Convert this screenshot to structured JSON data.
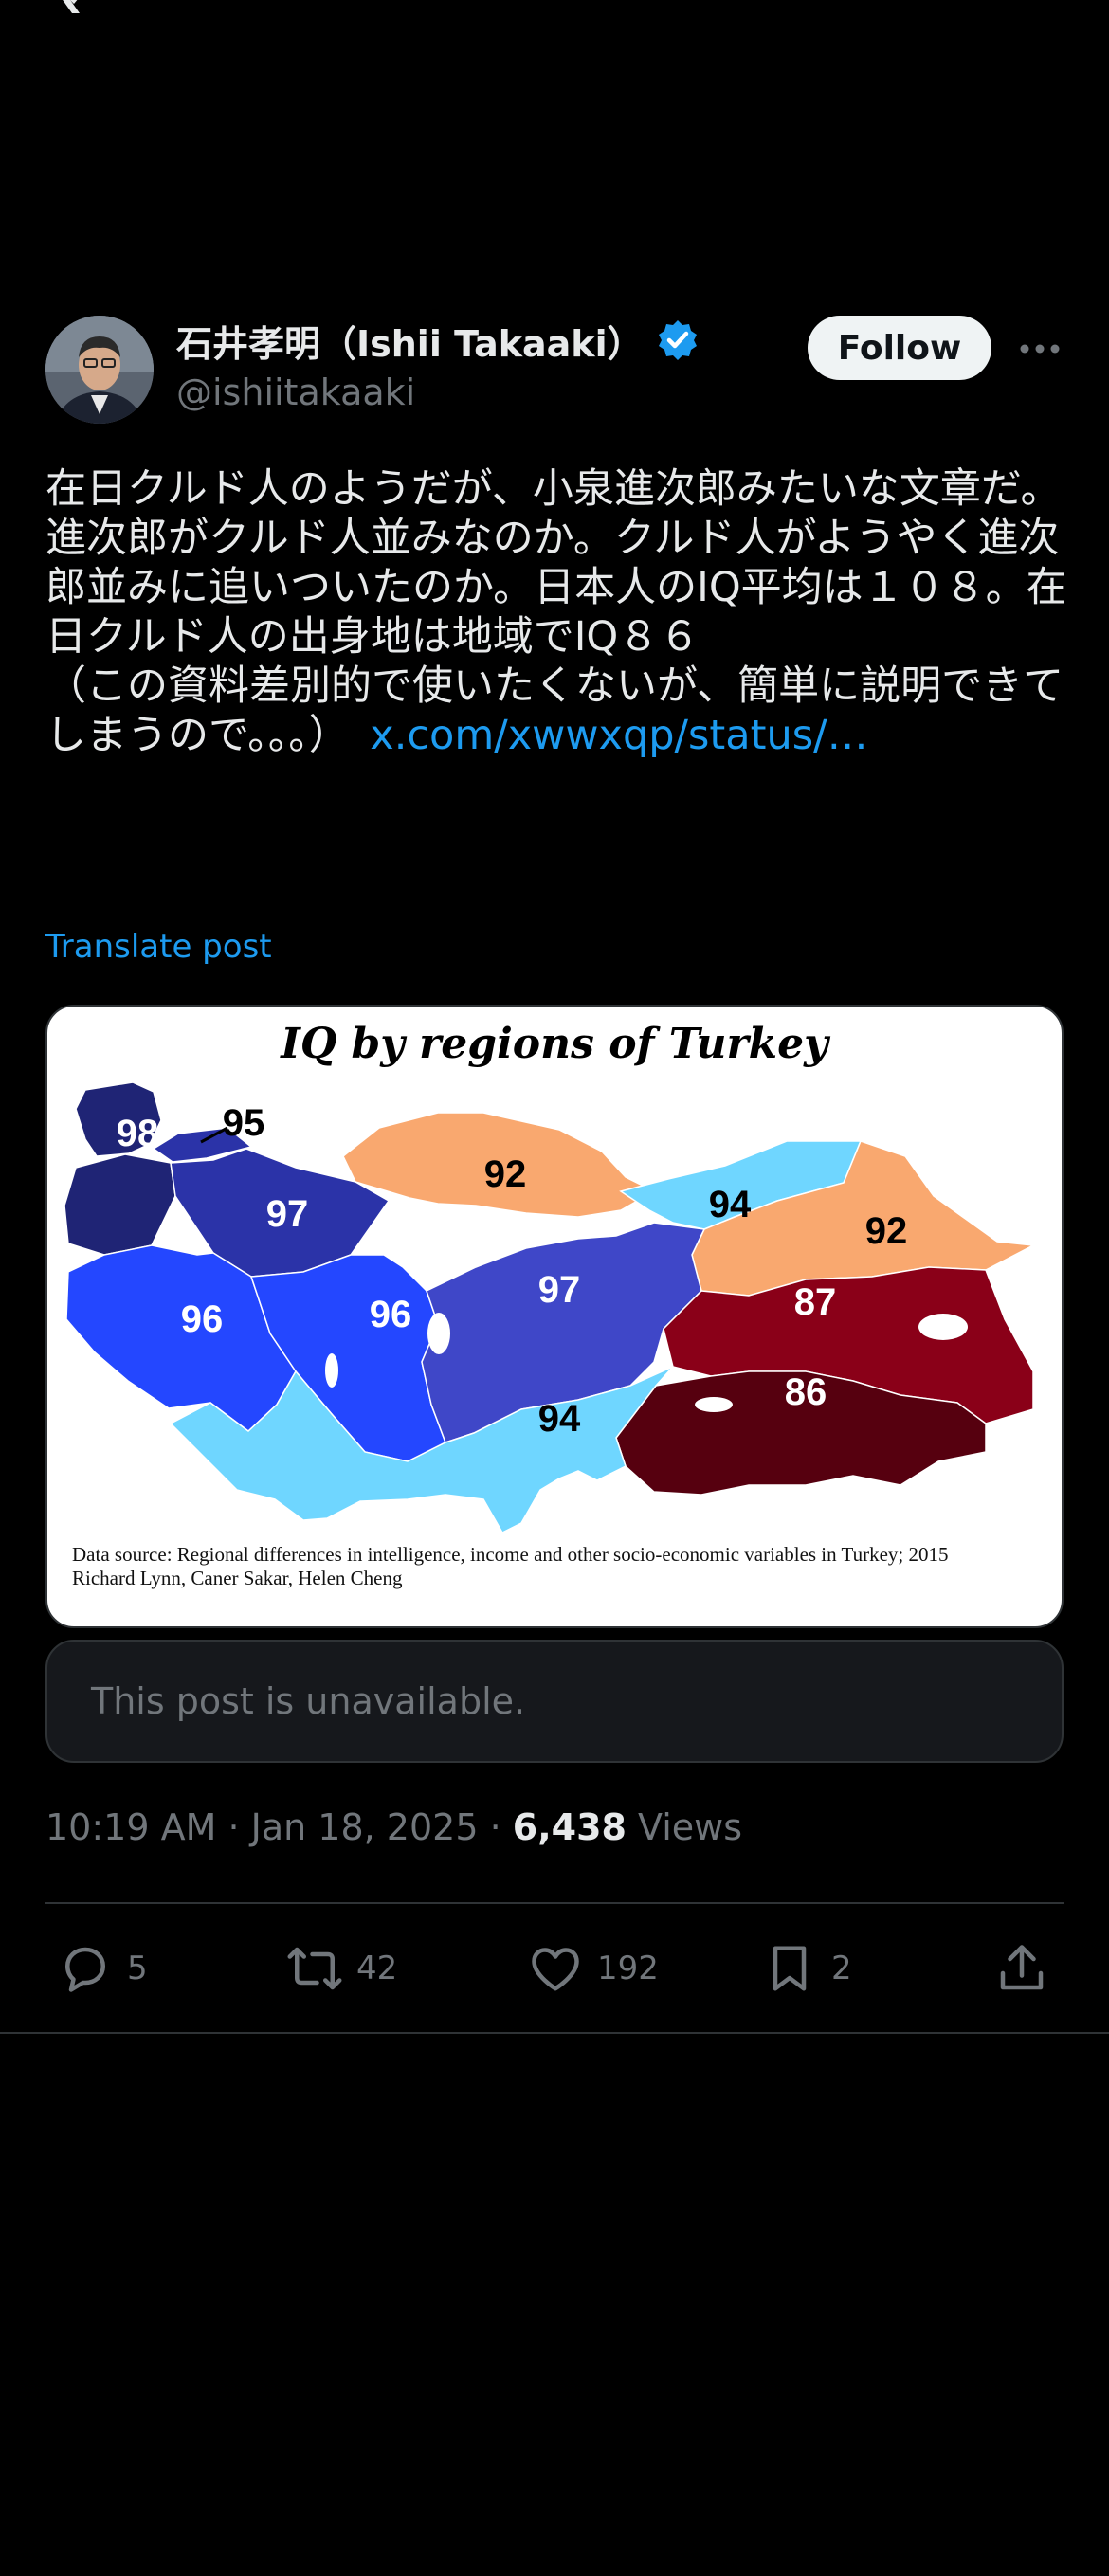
{
  "author": {
    "display_name": "石井孝明（Ishii Takaaki）",
    "handle": "@ishiitakaaki"
  },
  "follow_label": "Follow",
  "tweet": {
    "text": "在日クルド人のようだが、小泉進次郎みたいな文章だ。進次郎がクルド人並みなのか。クルド人がようやく進次郎並みに追いついたのか。日本人のIQ平均は１０８。在日クルド人の出身地は地域でIQ８６\n（この資料差別的で使いたくないが、簡単に説明できてしまうので。。。）　",
    "link": "x.com/xwwxqp/status/…",
    "translate_label": "Translate post"
  },
  "media": {
    "title": "IQ by regions of Turkey",
    "labels": [
      "98",
      "95",
      "92",
      "97",
      "94",
      "92",
      "96",
      "96",
      "97",
      "87",
      "86",
      "94"
    ],
    "source_line1": "Data source: Regional differences in intelligence, income and other socio-economic variables in Turkey; 2015",
    "source_line2": "Richard Lynn, Caner Sakar, Helen Cheng",
    "colors": {
      "navy": "#1f2475",
      "dark_blue": "#2b33a8",
      "medium_blue": "#3f47c8",
      "bright_blue": "#2447ff",
      "light_blue": "#6fd6ff",
      "orange": "#f9a86f",
      "maroon": "#8a0018",
      "dark_maroon": "#56000f"
    }
  },
  "quoted": {
    "unavailable_text": "This post is unavailable."
  },
  "meta": {
    "time": "10:19 AM",
    "date": "Jan 18, 2025",
    "views_count": "6,438",
    "views_label": "Views"
  },
  "actions": {
    "replies": "5",
    "reposts": "42",
    "likes": "192",
    "bookmarks": "2"
  },
  "icons": [
    "x-logo-icon",
    "verified-badge-icon",
    "more-icon",
    "reply-icon",
    "repost-icon",
    "like-icon",
    "bookmark-icon",
    "share-icon"
  ]
}
